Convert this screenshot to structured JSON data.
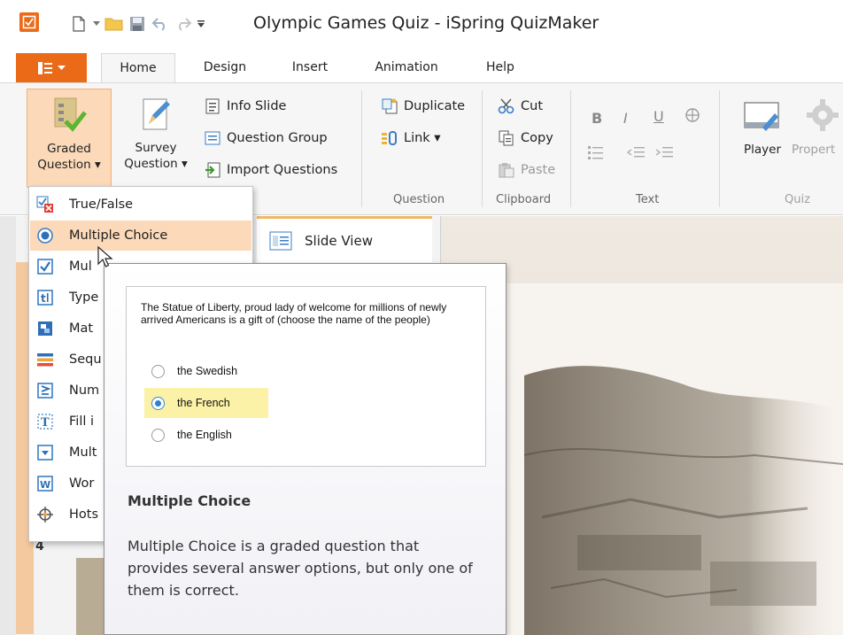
{
  "window": {
    "title": "Olympic Games Quiz - iSpring QuizMaker"
  },
  "ribbon_tabs": [
    "Home",
    "Design",
    "Insert",
    "Animation",
    "Help"
  ],
  "ribbon": {
    "graded_question": {
      "line1": "Graded",
      "line2": "Question ▾"
    },
    "survey_question": {
      "line1": "Survey",
      "line2": "Question ▾"
    },
    "info_slide": "Info Slide",
    "question_group": "Question Group",
    "import_questions": "Import Questions",
    "duplicate": "Duplicate",
    "link": "Link ▾",
    "cut": "Cut",
    "copy": "Copy",
    "paste": "Paste",
    "player": "Player",
    "properties": "Propert",
    "groups": {
      "question": "Question",
      "clipboard": "Clipboard",
      "text": "Text",
      "quiz": "Quiz"
    },
    "format": {
      "bold": "B",
      "italic": "I",
      "underline": "U"
    }
  },
  "slide_view_tab": "Slide View",
  "thumbnail_number": "4",
  "dropdown": {
    "items": [
      {
        "label": "True/False",
        "icon": "true-false-icon"
      },
      {
        "label": "Multiple Choice",
        "icon": "radio-button-icon"
      },
      {
        "label": "Mul",
        "icon": "checkbox-icon"
      },
      {
        "label": "Type",
        "icon": "type-in-icon"
      },
      {
        "label": "Mat",
        "icon": "matching-icon"
      },
      {
        "label": "Sequ",
        "icon": "sequence-icon"
      },
      {
        "label": "Num",
        "icon": "numeric-icon"
      },
      {
        "label": "Fill i",
        "icon": "fill-in-icon"
      },
      {
        "label": "Mult",
        "icon": "dropdown-icon"
      },
      {
        "label": "Wor",
        "icon": "word-bank-icon"
      },
      {
        "label": "Hots",
        "icon": "hotspot-icon"
      }
    ]
  },
  "tooltip": {
    "question": "The Statue of Liberty, proud lady of welcome for millions of newly arrived Americans is a gift of (choose the name of the people)",
    "options": [
      "the Swedish",
      "the French",
      "the English"
    ],
    "selected_index": 1,
    "title": "Multiple Choice",
    "description": "Multiple Choice is a graded question that provides several answer options, but only one of them is correct."
  },
  "colors": {
    "accent": "#ea6a17",
    "hover": "#fbd9b9",
    "selected_option": "#fbf1a7",
    "radio": "#2f7fd4"
  }
}
